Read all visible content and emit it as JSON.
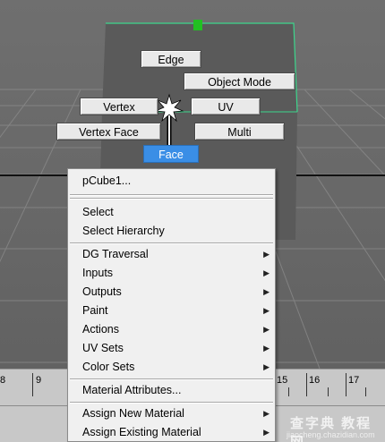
{
  "marking_menu": {
    "edge": "Edge",
    "object_mode": "Object Mode",
    "vertex": "Vertex",
    "uv": "UV",
    "vertex_face": "Vertex Face",
    "multi": "Multi",
    "face": "Face"
  },
  "timeline": {
    "ticks": [
      "8",
      "9",
      "15",
      "16",
      "17"
    ]
  },
  "context_menu": {
    "object_name": "pCube1...",
    "items": {
      "select": "Select",
      "select_hierarchy": "Select Hierarchy",
      "dg_traversal": "DG Traversal",
      "inputs": "Inputs",
      "outputs": "Outputs",
      "paint": "Paint",
      "actions": "Actions",
      "uv_sets": "UV Sets",
      "color_sets": "Color Sets",
      "material_attributes": "Material Attributes...",
      "assign_new_material": "Assign New Material",
      "assign_existing_material": "Assign Existing Material"
    },
    "submenu_arrow": "▶"
  },
  "watermark": {
    "line1": "查字典 教程网",
    "line2": "jiaocheng.chazidian.com"
  },
  "colors": {
    "cube": "#5a5a5a",
    "cube_outline": "#3cd68c",
    "selected_item": "#3a8ee6",
    "menu_bg": "#f0f0f0"
  }
}
